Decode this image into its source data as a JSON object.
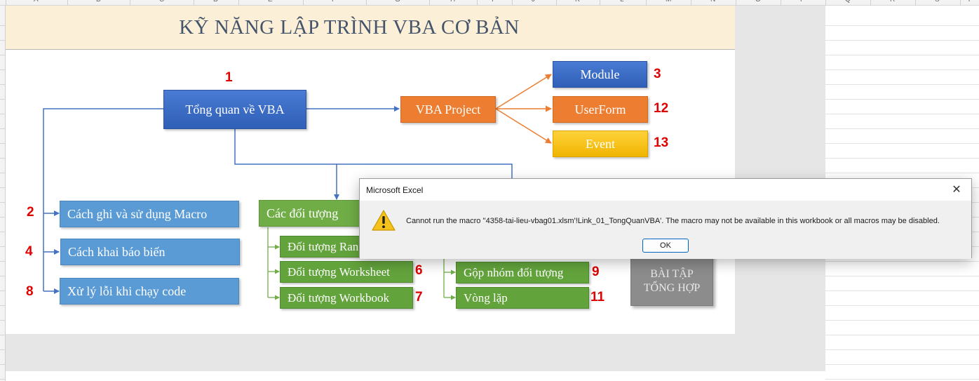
{
  "sheet": {
    "columns": [
      "A",
      "B",
      "C",
      "D",
      "E",
      "F",
      "G",
      "H",
      "I",
      "J",
      "K",
      "L",
      "M",
      "N",
      "O",
      "P",
      "Q",
      "R",
      "S",
      "T"
    ],
    "title": "KỸ NĂNG LẬP TRÌNH VBA CƠ BẢN"
  },
  "flowchart": {
    "overview": {
      "label": "Tổng quan về VBA",
      "number": "1"
    },
    "vba_project": {
      "label": "VBA Project"
    },
    "module": {
      "label": "Module",
      "number": "3"
    },
    "userform": {
      "label": "UserForm",
      "number": "12"
    },
    "event": {
      "label": "Event",
      "number": "13"
    },
    "left_items": [
      {
        "label": "Cách ghi và sử dụng Macro",
        "number": "2"
      },
      {
        "label": "Cách khai báo biến",
        "number": "4"
      },
      {
        "label": "Xử lý lỗi khi chạy code",
        "number": "8"
      }
    ],
    "objects": {
      "label": "Các đối tượng",
      "children": [
        {
          "label": "Đối tượng Range",
          "number": ""
        },
        {
          "label": "Đối tượng Worksheet",
          "number": "6"
        },
        {
          "label": "Đối tượng Workbook",
          "number": "7"
        }
      ]
    },
    "right_items": [
      {
        "label": "Gộp nhóm đối tượng",
        "number": "9"
      },
      {
        "label": "Vòng lặp",
        "number": "11"
      }
    ],
    "summary": {
      "line1": "BÀI TẬP",
      "line2": "TỔNG HỢP"
    }
  },
  "dialog": {
    "title": "Microsoft Excel",
    "close_glyph": "✕",
    "icon": "warning-icon",
    "message": "Cannot run the macro ''4358-tai-lieu-vbag01.xlsm'!Link_01_TongQuanVBA'. The macro may not be available in this workbook or all macros may be disabled.",
    "ok_label": "OK"
  },
  "colors": {
    "blue_dark": "#2f5fb6",
    "blue_light": "#5b9bd5",
    "orange": "#ed7d31",
    "yellow": "#ffc000",
    "green": "#70ad47",
    "number_red": "#e00000",
    "title_band": "#fcefd8"
  }
}
